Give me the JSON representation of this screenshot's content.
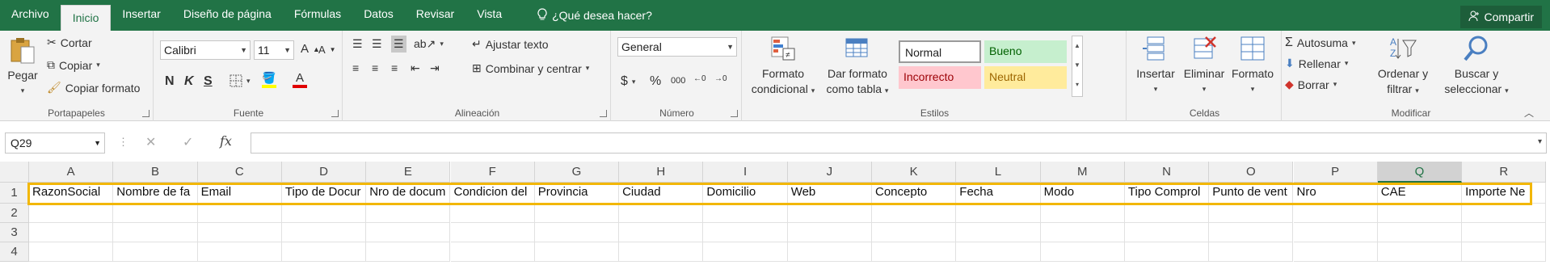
{
  "menu": {
    "tabs": [
      "Archivo",
      "Inicio",
      "Insertar",
      "Diseño de página",
      "Fórmulas",
      "Datos",
      "Revisar",
      "Vista"
    ],
    "tell_me": "¿Qué desea hacer?",
    "share": "Compartir"
  },
  "ribbon": {
    "clipboard": {
      "paste": "Pegar",
      "cut": "Cortar",
      "copy": "Copiar",
      "format_painter": "Copiar formato",
      "label": "Portapapeles"
    },
    "font": {
      "name": "Calibri",
      "size": "11",
      "bold": "N",
      "italic": "K",
      "underline": "S",
      "label": "Fuente"
    },
    "alignment": {
      "wrap": "Ajustar texto",
      "merge": "Combinar y centrar",
      "label": "Alineación"
    },
    "number": {
      "format": "General",
      "label": "Número"
    },
    "styles": {
      "conditional": [
        "Formato",
        "condicional"
      ],
      "table": [
        "Dar formato",
        "como tabla"
      ],
      "normal": "Normal",
      "good": "Bueno",
      "bad": "Incorrecto",
      "neutral": "Neutral",
      "label": "Estilos"
    },
    "cells": {
      "insert": "Insertar",
      "delete": "Eliminar",
      "format": "Formato",
      "label": "Celdas"
    },
    "editing": {
      "autosum": "Autosuma",
      "fill": "Rellenar",
      "clear": "Borrar",
      "sort": [
        "Ordenar y",
        "filtrar"
      ],
      "find": [
        "Buscar y",
        "seleccionar"
      ],
      "label": "Modificar"
    }
  },
  "formula_bar": {
    "name_box": "Q29",
    "fx": "fx",
    "content": ""
  },
  "sheet": {
    "columns": [
      "A",
      "B",
      "C",
      "D",
      "E",
      "F",
      "G",
      "H",
      "I",
      "J",
      "K",
      "L",
      "M",
      "N",
      "O",
      "P",
      "Q",
      "R"
    ],
    "selected_column": "Q",
    "rows": [
      "1",
      "2",
      "3",
      "4"
    ],
    "row1": [
      "RazonSocial",
      "Nombre de fa",
      "Email",
      "Tipo de Docur",
      "Nro de docum",
      "Condicion del",
      "Provincia",
      "Ciudad",
      "Domicilio",
      "Web",
      "Concepto",
      "Fecha",
      "Modo",
      "Tipo Comprol",
      "Punto de vent",
      "Nro",
      "CAE",
      "Importe Ne"
    ]
  },
  "colors": {
    "accent": "#217346",
    "highlight": "#f2b705"
  }
}
